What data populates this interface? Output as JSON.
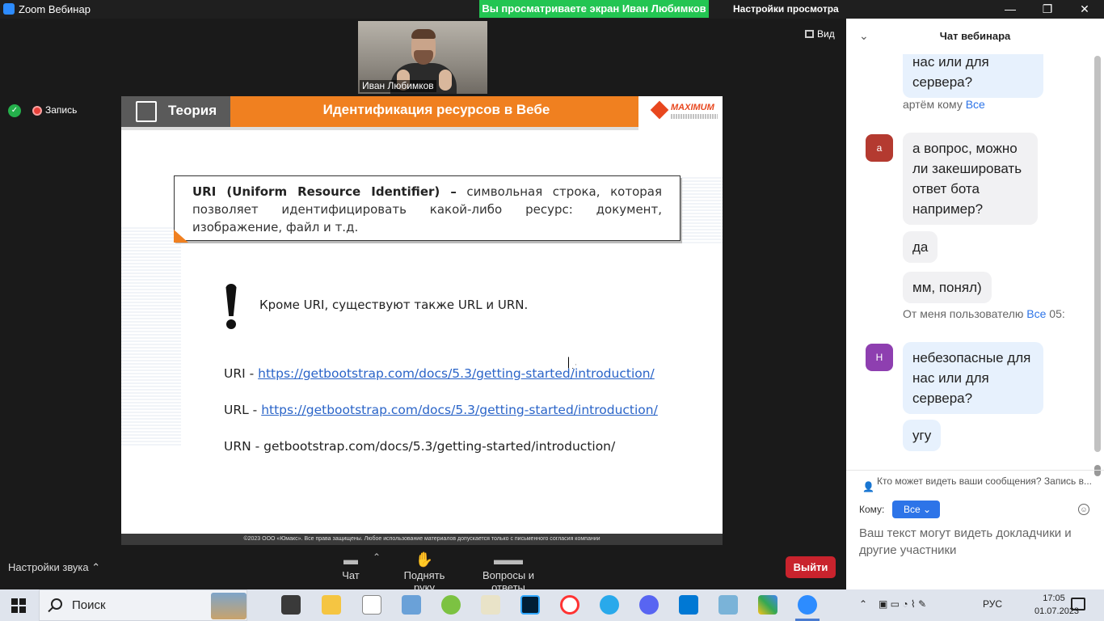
{
  "window": {
    "title": "Zoom Вебинар",
    "share_banner": "Вы просматриваете экран Иван Любимков",
    "view_settings": "Настройки просмотра",
    "minimize": "—",
    "restore": "❐",
    "close": "✕"
  },
  "meeting": {
    "speaker_name": "Иван Любимков",
    "view_label": "Вид",
    "recording_label": "Запись",
    "audio_settings": "Настройки звука",
    "toolbar": [
      {
        "label": "Чат",
        "icon": "chat-icon"
      },
      {
        "label": "Поднять руку",
        "icon": "hand-icon"
      },
      {
        "label": "Вопросы и ответы",
        "icon": "qa-icon"
      }
    ],
    "leave_label": "Выйти"
  },
  "slide": {
    "section": "Теория",
    "title": "Идентификация ресурсов в Вебе",
    "logo": "MAXIMUM",
    "definition_term": "URI (Uniform Resource Identifier) –",
    "definition_text": " символьная строка, которая позволяет идентифицировать какой-либо ресурс: документ, изображение, файл и т.д.",
    "note": "Кроме URI, существуют также URL и URN.",
    "uri_prefix": "URI - ",
    "uri_link": "https://getbootstrap.com/docs/5.3/getting-started/introduction/",
    "url_prefix": "URL - ",
    "url_link": "https://getbootstrap.com/docs/5.3/getting-started/introduction/",
    "urn_text": "URN - getbootstrap.com/docs/5.3/getting-started/introduction/",
    "footer": "©2023 ООО «Юмакс». Все права защищены. Любое использование материалов допускается только с письменного согласия компании"
  },
  "chat": {
    "title": "Чат вебинара",
    "messages": {
      "m0_text": "нас или для сервера?",
      "m1_sender": "артём кому ",
      "m1_to": "Все",
      "m1_avatar": "а",
      "m1_text": "а вопрос, можно ли закешировать ответ бота например?",
      "m2_text": "да",
      "m3_text": "мм, понял)",
      "m4_sender": "От меня пользователю ",
      "m4_to": "Все",
      "m4_time": " 05:",
      "m4_avatar": "Н",
      "m4_text": "небезопасные для нас или для сервера?",
      "m5_text": "угу"
    },
    "privacy": "Кто может видеть ваши сообщения? Запись в...",
    "to_label": "Кому:",
    "to_value": "Все",
    "input_placeholder": "Ваш текст могут видеть докладчики и другие участники"
  },
  "taskbar": {
    "search_placeholder": "Поиск",
    "lang": "РУС",
    "time": "17:05",
    "date": "01.07.2023",
    "colors": {
      "accent": "#2d8cff",
      "zoom_green": "#23c552",
      "leave_red": "#c9232d"
    }
  }
}
